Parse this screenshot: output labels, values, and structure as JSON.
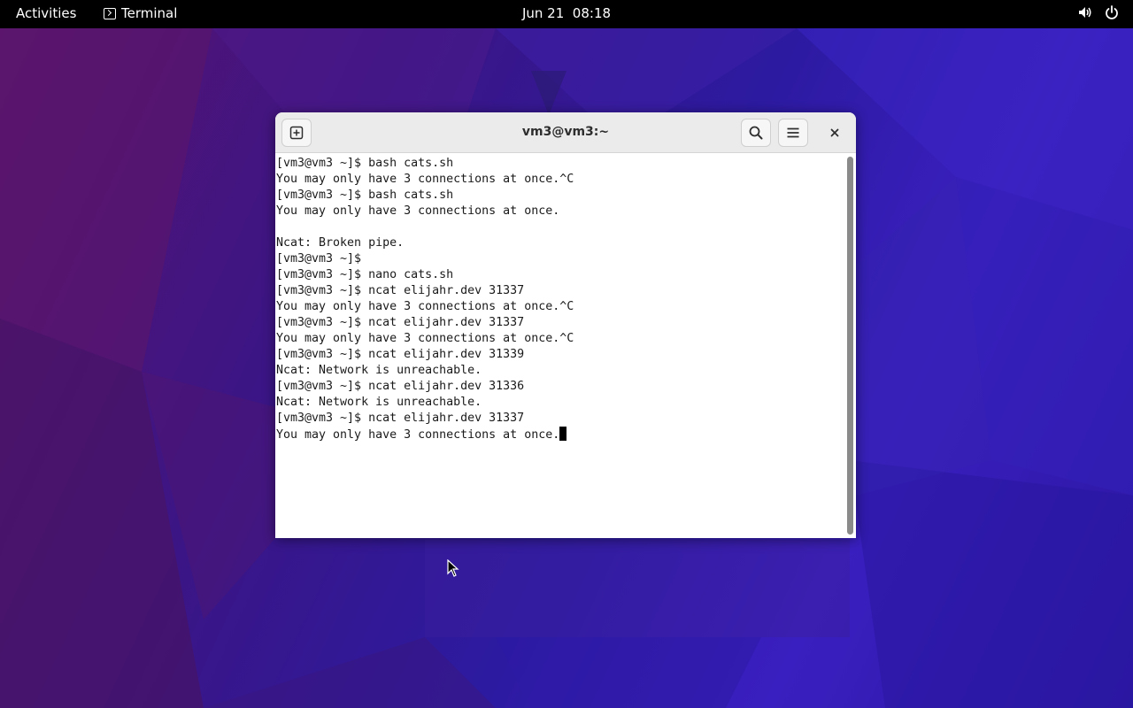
{
  "topbar": {
    "activities_label": "Activities",
    "app_name": "Terminal",
    "clock": "Jun 21  08:18",
    "tray_icons": [
      "volume-icon",
      "power-icon"
    ]
  },
  "window": {
    "title": "vm3@vm3:~",
    "buttons": [
      "new-tab-icon",
      "search-icon",
      "menu-icon",
      "close-icon"
    ]
  },
  "terminal": {
    "lines": [
      "[vm3@vm3 ~]$ bash cats.sh",
      "You may only have 3 connections at once.^C",
      "[vm3@vm3 ~]$ bash cats.sh",
      "You may only have 3 connections at once.",
      "",
      "Ncat: Broken pipe.",
      "[vm3@vm3 ~]$",
      "[vm3@vm3 ~]$ nano cats.sh",
      "[vm3@vm3 ~]$ ncat elijahr.dev 31337",
      "You may only have 3 connections at once.^C",
      "[vm3@vm3 ~]$ ncat elijahr.dev 31337",
      "You may only have 3 connections at once.^C",
      "[vm3@vm3 ~]$ ncat elijahr.dev 31339",
      "Ncat: Network is unreachable.",
      "[vm3@vm3 ~]$ ncat elijahr.dev 31336",
      "Ncat: Network is unreachable.",
      "[vm3@vm3 ~]$ ncat elijahr.dev 31337",
      "You may only have 3 connections at once."
    ]
  },
  "colors": {
    "topbar_bg": "#000000",
    "headerbar_bg": "#ebebeb",
    "terminal_bg": "#ffffff",
    "terminal_fg": "#1a1a1a"
  }
}
